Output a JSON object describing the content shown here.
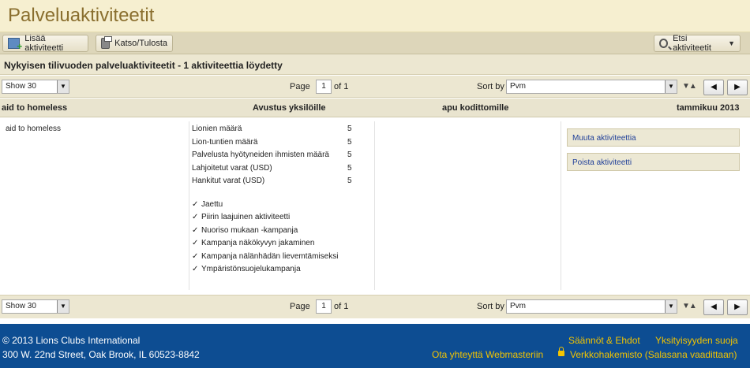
{
  "page": {
    "title": "Palveluaktiviteetit"
  },
  "toolbar": {
    "add_label": "Lisää aktiviteetti",
    "print_label": "Katso/Tulosta",
    "search_label": "Etsi aktiviteetit"
  },
  "summary": "Nykyisen tilivuoden palveluaktiviteetit - 1 aktiviteettia löydetty",
  "pager": {
    "show": "Show 30",
    "page_label": "Page",
    "page": "1",
    "of_label": "of 1",
    "sort_label": "Sort by",
    "sort_value": "Pvm"
  },
  "activity": {
    "name_header": "aid to homeless",
    "type": "Avustus yksilöille",
    "category": "apu kodittomille",
    "date": "tammikuu 2013",
    "name": "aid to homeless",
    "stats": [
      {
        "label": "Lionien määrä",
        "value": "5"
      },
      {
        "label": "Lion-tuntien määrä",
        "value": "5"
      },
      {
        "label": "Palvelusta hyötyneiden ihmisten määrä",
        "value": "5"
      },
      {
        "label": "Lahjoitetut varat (USD)",
        "value": "5"
      },
      {
        "label": "Hankitut varat (USD)",
        "value": "5"
      }
    ],
    "checks": [
      "Jaettu",
      "Piirin laajuinen aktiviteetti",
      "Nuoriso mukaan -kampanja",
      "Kampanja näkökyvyn jakaminen",
      "Kampanja nälänhädän lievemtämiseksi",
      "Ympäristönsuojelukampanja"
    ],
    "more_label": "Muuta aktiviteettia",
    "delete_label": "Poista aktiviteetti"
  },
  "footer": {
    "copyright": "© 2013 Lions Clubs International",
    "address": "300 W. 22nd Street, Oak Brook, IL 60523-8842",
    "terms": "Säännöt & Ehdot",
    "privacy": "Yksityisyyden suoja",
    "webmaster": "Ota yhteyttä Webmasteriin",
    "directory": "Verkkohakemisto (Salasana vaadittaan)"
  },
  "colors": {
    "title": "#8a6f2f",
    "footer_bg": "#0d4d92",
    "footer_link": "#f3c400",
    "action_link": "#1f3f99"
  },
  "icons": [
    "add-activity-icon",
    "print-icon",
    "search-icon",
    "lock-icon"
  ]
}
